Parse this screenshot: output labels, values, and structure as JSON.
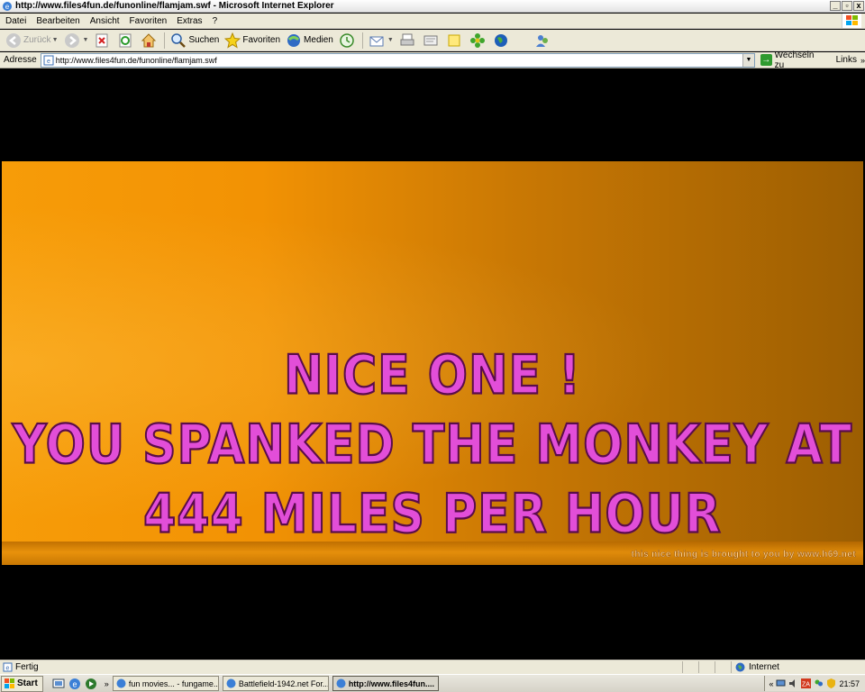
{
  "window": {
    "title": "http://www.files4fun.de/funonline/flamjam.swf - Microsoft Internet Explorer",
    "controls": [
      "_",
      "▫",
      "x"
    ]
  },
  "menu": [
    "Datei",
    "Bearbeiten",
    "Ansicht",
    "Favoriten",
    "Extras",
    "?"
  ],
  "toolbar": {
    "back": "Zurück",
    "search": "Suchen",
    "favorites": "Favoriten",
    "media": "Medien"
  },
  "address": {
    "label": "Adresse",
    "url": "http://www.files4fun.de/funonline/flamjam.swf",
    "go": "Wechseln zu",
    "links": "Links",
    "links_more": "»"
  },
  "flash": {
    "line1": "NICE ONE !",
    "line2": "YOU SPANKED THE MONKEY AT",
    "line3": "444 MILES PER HOUR",
    "credit": "this nice thing is brought to you by www.h69.net"
  },
  "status": {
    "text": "Fertig",
    "zone": "Internet"
  },
  "taskbar": {
    "start": "Start",
    "quicklaunch_more": "»",
    "tasks": [
      {
        "label": "fun movies... - fungame..."
      },
      {
        "label": "Battlefield-1942.net For..."
      },
      {
        "label": "http://www.files4fun...."
      }
    ],
    "tray_arrow": "«",
    "clock": "21:57"
  },
  "colors": {
    "flash_text": "#e24ed8",
    "flash_outline": "#5a0c4a",
    "banner": "#f29204"
  }
}
